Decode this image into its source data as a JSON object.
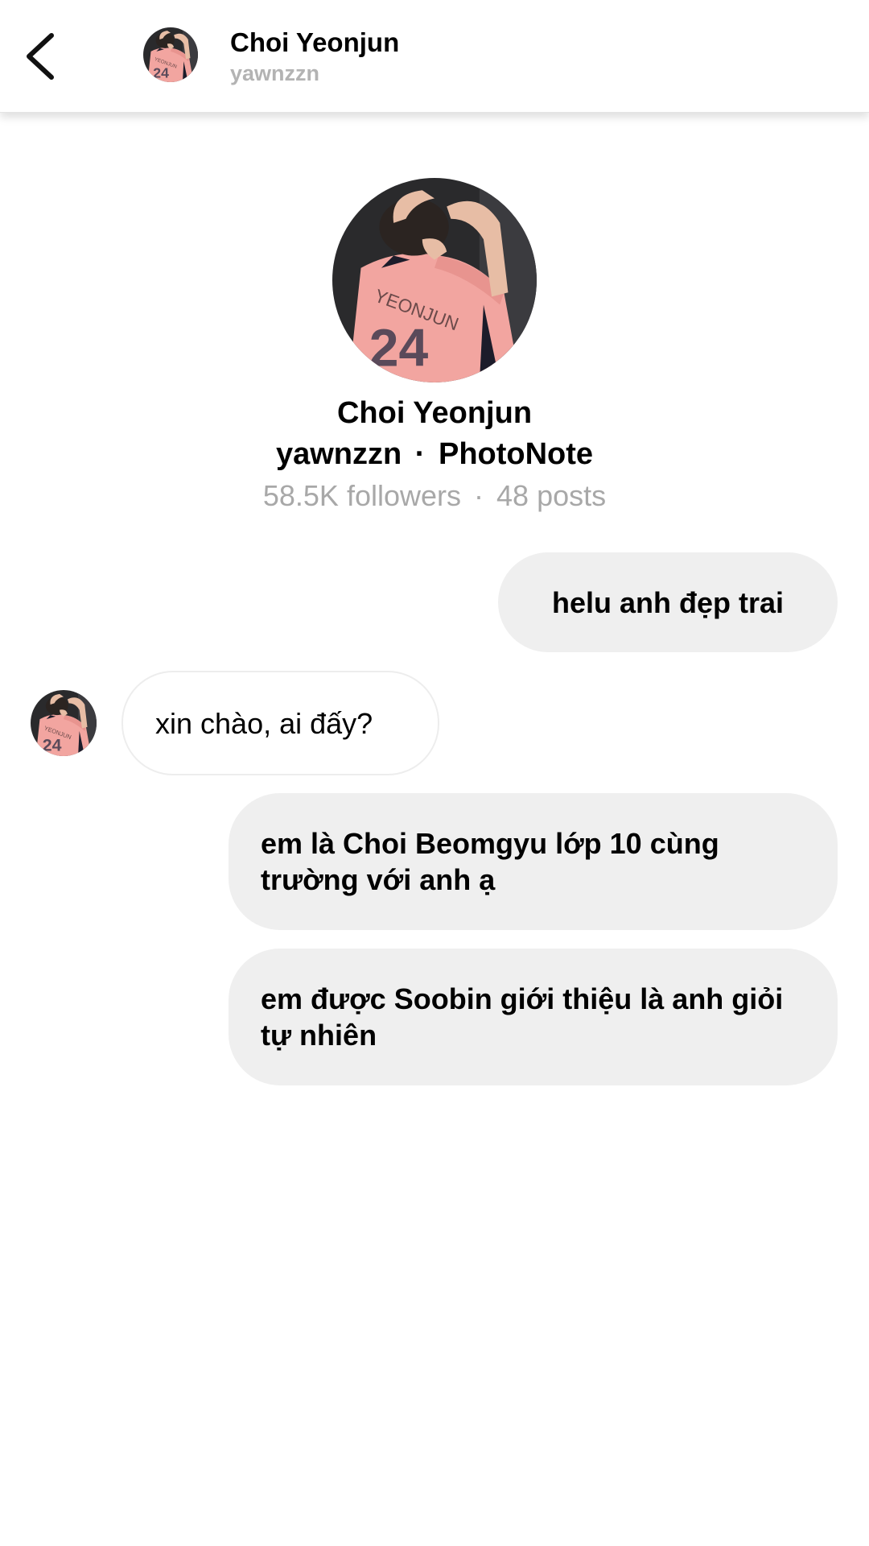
{
  "header": {
    "back_icon": "chevron-left-icon",
    "name": "Choi Yeonjun",
    "username": "yawnzzn"
  },
  "profile": {
    "name": "Choi Yeonjun",
    "username": "yawnzzn",
    "app": "PhotoNote",
    "sub_separator": "·",
    "followers": "58.5K followers",
    "stats_separator": "·",
    "posts": "48 posts"
  },
  "messages": [
    {
      "sender": "me",
      "text": "helu anh đẹp trai"
    },
    {
      "sender": "them",
      "text": "xin chào, ai đấy?"
    },
    {
      "sender": "me",
      "text": "em là Choi Beomgyu lớp 10 cùng trường với anh ạ"
    },
    {
      "sender": "me",
      "text": "em được Soobin giới thiệu là anh giỏi tự nhiên"
    }
  ],
  "colors": {
    "outgoing_bubble": "#efefef",
    "incoming_bubble_border": "#ededed",
    "secondary_text": "#a8a8a8",
    "avatar_jersey": "#f2a5a0"
  }
}
